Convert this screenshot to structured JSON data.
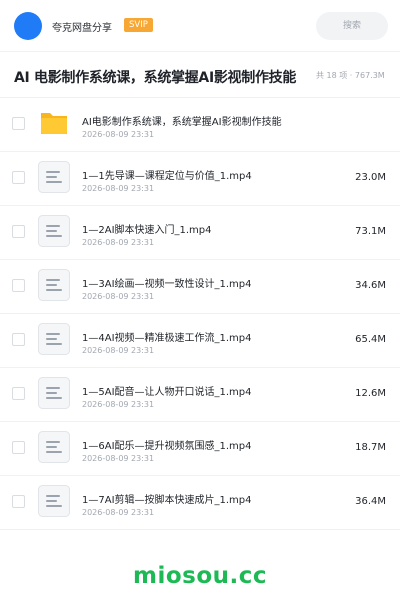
{
  "header": {
    "owner": "夸克网盘分享",
    "badge": "SVIP",
    "search_placeholder": "搜索",
    "brand_color": "#1f7cf6",
    "badge_color": "#f7a733"
  },
  "share": {
    "title": "AI 电影制作系统课，系统掌握AI影视制作技能",
    "meta": "共 18 项 · 767.3M"
  },
  "files": [
    {
      "name": "AI电影制作系统课，系统掌握AI影视制作技能",
      "date": "2026-08-09 23:31",
      "size": "",
      "icon": "folder-icon"
    },
    {
      "name": "1—1先导课—课程定位与价值_1.mp4",
      "date": "2026-08-09 23:31",
      "size": "23.0M",
      "icon": "video-file-icon"
    },
    {
      "name": "1—2AI脚本快速入门_1.mp4",
      "date": "2026-08-09 23:31",
      "size": "73.1M",
      "icon": "video-file-icon"
    },
    {
      "name": "1—3AI绘画—视频一致性设计_1.mp4",
      "date": "2026-08-09 23:31",
      "size": "34.6M",
      "icon": "video-file-icon"
    },
    {
      "name": "1—4AI视频—精准极速工作流_1.mp4",
      "date": "2026-08-09 23:31",
      "size": "65.4M",
      "icon": "video-file-icon"
    },
    {
      "name": "1—5AI配音—让人物开口说话_1.mp4",
      "date": "2026-08-09 23:31",
      "size": "12.6M",
      "icon": "video-file-icon"
    },
    {
      "name": "1—6AI配乐—提升视频氛围感_1.mp4",
      "date": "2026-08-09 23:31",
      "size": "18.7M",
      "icon": "video-file-icon"
    },
    {
      "name": "1—7AI剪辑—按脚本快速成片_1.mp4",
      "date": "2026-08-09 23:31",
      "size": "36.4M",
      "icon": "video-file-icon"
    }
  ],
  "footer": {
    "watermark": "miosou.cc",
    "watermark_color": "#1db954"
  }
}
